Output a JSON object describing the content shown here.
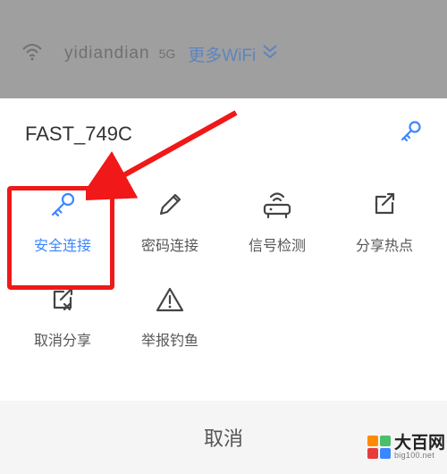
{
  "background": {
    "ssid": "yidiandian",
    "five_g": "5G",
    "more_wifi": "更多WiFi"
  },
  "sheet": {
    "title": "FAST_749C",
    "tiles": [
      {
        "key": "secure-connect",
        "label": "安全连接",
        "icon": "key-icon",
        "accent": true
      },
      {
        "key": "password-connect",
        "label": "密码连接",
        "icon": "pencil-icon",
        "accent": false
      },
      {
        "key": "signal-check",
        "label": "信号检测",
        "icon": "router-icon",
        "accent": false
      },
      {
        "key": "share-hotspot",
        "label": "分享热点",
        "icon": "share-out-icon",
        "accent": false
      },
      {
        "key": "cancel-share",
        "label": "取消分享",
        "icon": "share-cancel-icon",
        "accent": false
      },
      {
        "key": "report-phishing",
        "label": "举报钓鱼",
        "icon": "warning-icon",
        "accent": false
      }
    ],
    "cancel": "取消"
  },
  "annotation": {
    "highlight_target": "secure-connect",
    "arrow_color": "#f01818"
  },
  "watermark": {
    "text": "大百网",
    "url": "big100.net",
    "colors": [
      "#ff8a00",
      "#49c06b",
      "#e73c3c",
      "#3b87ff"
    ]
  },
  "colors": {
    "accent": "#3b87ff",
    "highlight": "#f01818",
    "icon": "#444"
  }
}
